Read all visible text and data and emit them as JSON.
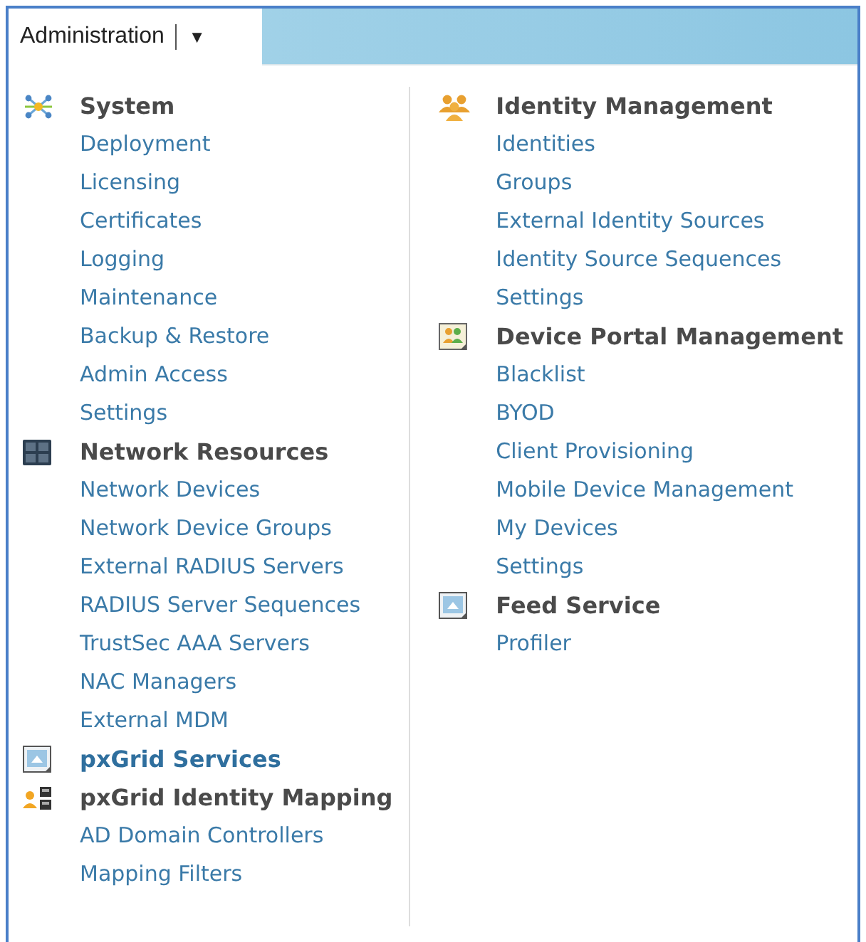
{
  "tab": {
    "label": "Administration",
    "caret": "▼"
  },
  "columns": [
    {
      "sections": [
        {
          "kind": "hub",
          "title": "System",
          "linked": false,
          "items": [
            "Deployment",
            "Licensing",
            "Certificates",
            "Logging",
            "Maintenance",
            "Backup & Restore",
            "Admin Access",
            "Settings"
          ]
        },
        {
          "kind": "grid",
          "title": "Network Resources",
          "linked": false,
          "items": [
            "Network Devices",
            "Network Device Groups",
            "External RADIUS Servers",
            "RADIUS Server Sequences",
            "TrustSec AAA Servers",
            "NAC Managers",
            "External MDM"
          ]
        },
        {
          "kind": "screen",
          "title": "pxGrid Services",
          "linked": true
        },
        {
          "kind": "person-device",
          "title": "pxGrid Identity Mapping",
          "linked": false,
          "items": [
            "AD Domain Controllers",
            "Mapping Filters"
          ]
        }
      ]
    },
    {
      "sections": [
        {
          "kind": "people",
          "title": "Identity Management",
          "linked": false,
          "items": [
            "Identities",
            "Groups",
            "External Identity Sources",
            "Identity Source Sequences",
            "Settings"
          ]
        },
        {
          "kind": "people-box",
          "title": "Device Portal Management",
          "linked": false,
          "items": [
            "Blacklist",
            "BYOD",
            "Client Provisioning",
            "Mobile Device Management",
            "My Devices",
            "Settings"
          ]
        },
        {
          "kind": "screen",
          "title": "Feed Service",
          "linked": false,
          "items": [
            "Profiler"
          ]
        }
      ]
    }
  ]
}
